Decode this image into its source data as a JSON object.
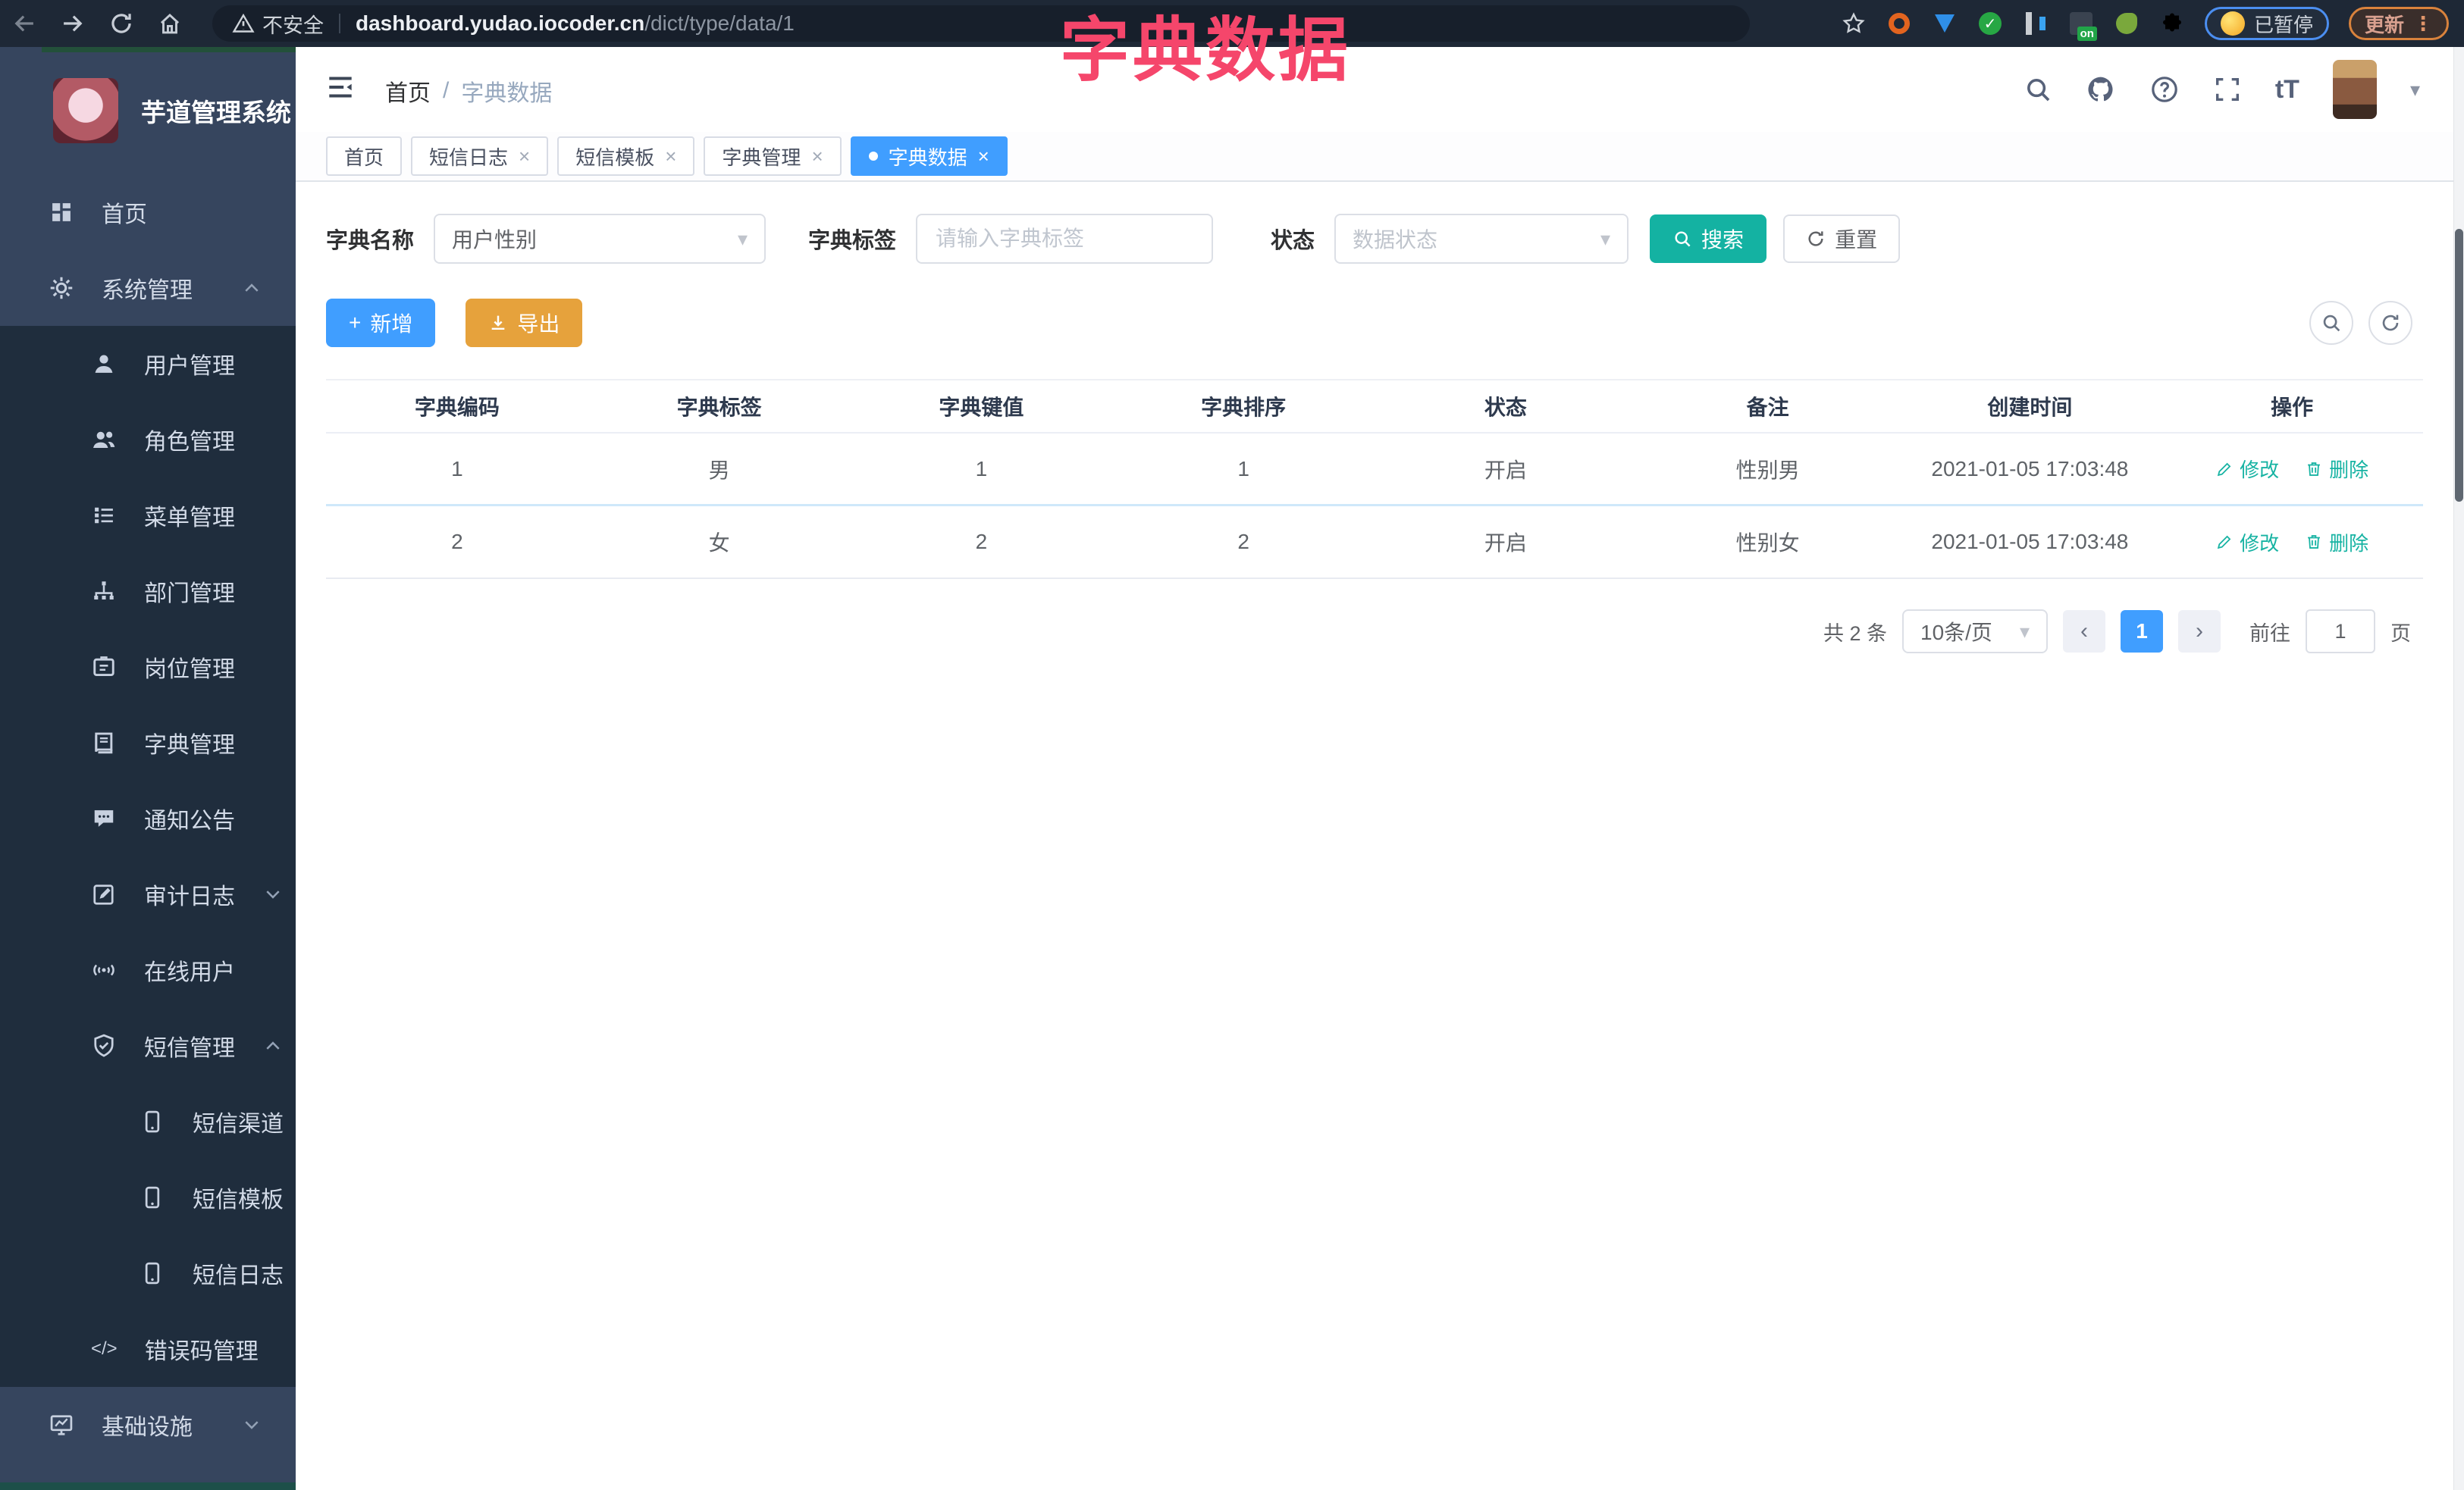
{
  "colors": {
    "accent": "#409eff",
    "teal": "#14b2a2",
    "warning": "#e6a23c",
    "annotation": "#f5466b"
  },
  "browser": {
    "security": "不安全",
    "url_host": "dashboard.yudao.iocoder.cn",
    "url_path": "/dict/type/data/1",
    "paused_badge": "已暂停",
    "update_button": "更新",
    "extension_on_badge": "on"
  },
  "annotation": {
    "title": "字典数据"
  },
  "sidebar": {
    "title": "芋道管理系统",
    "items": [
      {
        "label": "首页"
      },
      {
        "label": "系统管理"
      },
      {
        "label": "用户管理"
      },
      {
        "label": "角色管理"
      },
      {
        "label": "菜单管理"
      },
      {
        "label": "部门管理"
      },
      {
        "label": "岗位管理"
      },
      {
        "label": "字典管理"
      },
      {
        "label": "通知公告"
      },
      {
        "label": "审计日志"
      },
      {
        "label": "在线用户"
      },
      {
        "label": "短信管理"
      },
      {
        "label": "短信渠道"
      },
      {
        "label": "短信模板"
      },
      {
        "label": "短信日志"
      },
      {
        "label": "错误码管理"
      },
      {
        "label": "基础设施"
      }
    ]
  },
  "header": {
    "breadcrumb": {
      "home": "首页",
      "sep": "/",
      "current": "字典数据"
    }
  },
  "tabs": [
    {
      "label": "首页"
    },
    {
      "label": "短信日志"
    },
    {
      "label": "短信模板"
    },
    {
      "label": "字典管理"
    },
    {
      "label": "字典数据"
    }
  ],
  "filters": {
    "name_label": "字典名称",
    "name_value": "用户性别",
    "tag_label": "字典标签",
    "tag_placeholder": "请输入字典标签",
    "status_label": "状态",
    "status_placeholder": "数据状态",
    "search": "搜索",
    "reset": "重置"
  },
  "toolbar": {
    "add": "新增",
    "export": "导出"
  },
  "table": {
    "columns": [
      "字典编码",
      "字典标签",
      "字典键值",
      "字典排序",
      "状态",
      "备注",
      "创建时间",
      "操作"
    ],
    "rows": [
      {
        "code": "1",
        "label": "男",
        "value": "1",
        "sort": "1",
        "status": "开启",
        "remark": "性别男",
        "time": "2021-01-05 17:03:48"
      },
      {
        "code": "2",
        "label": "女",
        "value": "2",
        "sort": "2",
        "status": "开启",
        "remark": "性别女",
        "time": "2021-01-05 17:03:48"
      }
    ],
    "edit": "修改",
    "delete": "删除"
  },
  "pagination": {
    "total": "共 2 条",
    "size": "10条/页",
    "page": "1",
    "goto": "前往",
    "unit": "页",
    "goto_value": "1"
  },
  "icons": {
    "prev": "‹",
    "next": "›",
    "close": "×",
    "caret_down": "▾",
    "dot": "●",
    "menu_dots": "⋮",
    "slash": "/",
    "font_size": "tT",
    "plus": "+",
    "code": "</>",
    "online": "((ø))"
  }
}
